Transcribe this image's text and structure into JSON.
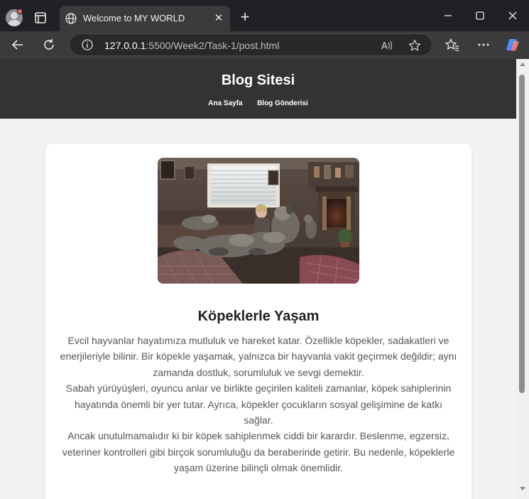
{
  "browser": {
    "tab_title": "Welcome to MY WORLD",
    "url_host": "127.0.0.1",
    "url_rest": ":5500/Week2/Task-1/post.html",
    "close_glyph": "✕",
    "newtab_glyph": "+"
  },
  "site": {
    "title": "Blog Sitesi",
    "nav": [
      "Ana Sayfa",
      "Blog Gönderisi"
    ]
  },
  "post": {
    "image_alt": "Köpeklerle Yaşam",
    "title": "Köpeklerle Yaşam",
    "paragraphs": [
      "Evcil hayvanlar hayatımıza mutluluk ve hareket katar. Özellikle köpekler, sadakatleri ve enerjileriyle bilinir. Bir köpekle yaşamak, yalnızca bir hayvanla vakit geçirmek değildir; aynı zamanda dostluk, sorumluluk ve sevgi demektir.",
      "Sabah yürüyüşleri, oyuncu anlar ve birlikte geçirilen kaliteli zamanlar, köpek sahiplerinin hayatında önemli bir yer tutar. Ayrıca, köpekler çocukların sosyal gelişimine de katkı sağlar.",
      "Ancak unutulmamalıdır ki bir köpek sahiplenmek ciddi bir karardır. Beslenme, egzersiz, veteriner kontrolleri gibi birçok sorumluluğu da beraberinde getirir. Bu nedenle, köpeklerle yaşam üzerine bilinçli olmak önemlidir."
    ]
  },
  "colors": {
    "header_bg": "#333333",
    "page_bg": "#f2f2f2",
    "card_bg": "#ffffff",
    "text": "#555555",
    "title": "#222222"
  },
  "icons": [
    "profile-icon",
    "tab-actions-icon",
    "globe-icon",
    "close-icon",
    "new-tab-icon",
    "minimize-icon",
    "maximize-icon",
    "window-close-icon",
    "back-icon",
    "reload-icon",
    "info-icon",
    "read-aloud-icon",
    "favorite-star-icon",
    "favorites-icon",
    "more-icon",
    "copilot-icon"
  ]
}
